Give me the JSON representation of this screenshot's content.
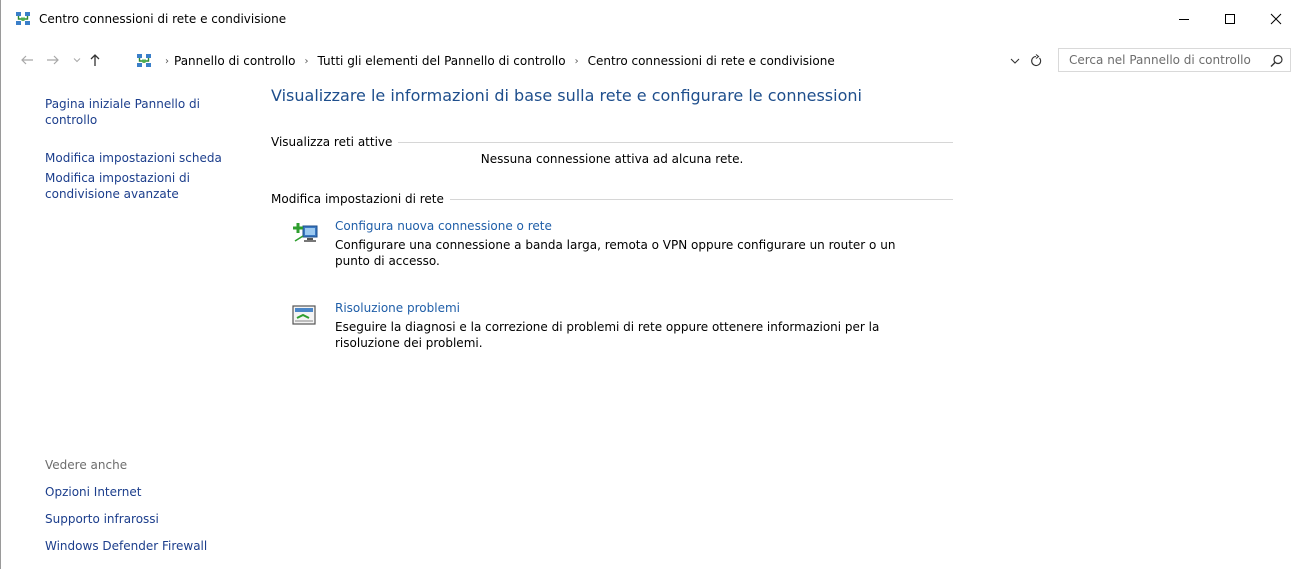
{
  "window": {
    "title": "Centro connessioni di rete e condivisione",
    "icon": "network-center-icon"
  },
  "address_bar": {
    "crumbs": [
      "Pannello di controllo",
      "Tutti gli elementi del Pannello di controllo",
      "Centro connessioni di rete e condivisione"
    ]
  },
  "search": {
    "placeholder": "Cerca nel Pannello di controllo"
  },
  "left_pane": {
    "links": [
      "Pagina iniziale Pannello di controllo",
      "Modifica impostazioni scheda",
      "Modifica impostazioni di condivisione avanzate"
    ],
    "see_also_label": "Vedere anche",
    "see_also": [
      "Opzioni Internet",
      "Supporto infrarossi",
      "Windows Defender Firewall"
    ]
  },
  "main": {
    "title": "Visualizzare le informazioni di base sulla rete e configurare le connessioni",
    "active_networks_label": "Visualizza reti attive",
    "no_connection_text": "Nessuna connessione attiva ad alcuna rete.",
    "change_settings_label": "Modifica impostazioni di rete",
    "tasks": [
      {
        "title": "Configura nuova connessione o rete",
        "description": "Configurare una connessione a banda larga, remota o VPN oppure configurare un router o un punto di accesso.",
        "icon": "new-connection-icon"
      },
      {
        "title": "Risoluzione problemi",
        "description": "Eseguire la diagnosi e la correzione di problemi di rete oppure ottenere informazioni per la risoluzione dei problemi.",
        "icon": "troubleshoot-icon"
      }
    ]
  },
  "colors": {
    "link": "#1c3e8c",
    "title": "#1e4e8c",
    "muted": "#6d6d6d"
  }
}
